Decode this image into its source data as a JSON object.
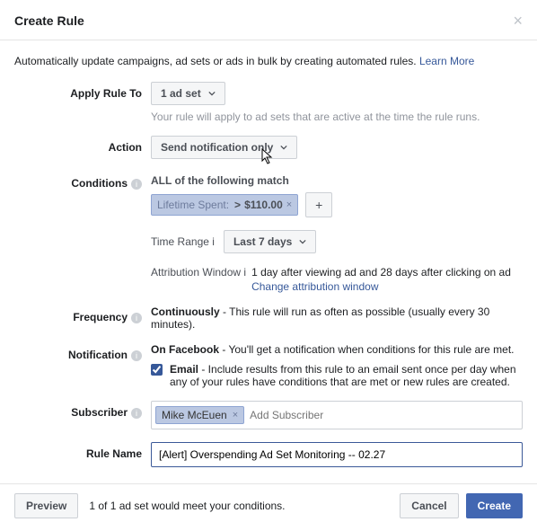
{
  "header": {
    "title": "Create Rule"
  },
  "intro": {
    "text": "Automatically update campaigns, ad sets or ads in bulk by creating automated rules.",
    "learn_more": "Learn More"
  },
  "labels": {
    "apply_rule_to": "Apply Rule To",
    "action": "Action",
    "conditions": "Conditions",
    "frequency": "Frequency",
    "notification": "Notification",
    "subscriber": "Subscriber",
    "rule_name": "Rule Name"
  },
  "apply": {
    "selected": "1 ad set",
    "hint": "Your rule will apply to ad sets that are active at the time the rule runs."
  },
  "action": {
    "selected": "Send notification only"
  },
  "conditions": {
    "match_text": "ALL of the following match",
    "chip": {
      "label": "Lifetime Spent:",
      "op": ">",
      "value": "$110.00"
    },
    "time_range_label": "Time Range",
    "time_range_value": "Last 7 days",
    "attr_label": "Attribution Window",
    "attr_text": "1 day after viewing ad and 28 days after clicking on ad",
    "attr_link": "Change attribution window"
  },
  "frequency": {
    "bold": "Continuously",
    "rest": " - This rule will run as often as possible (usually every 30 minutes)."
  },
  "notification": {
    "fb_bold": "On Facebook",
    "fb_rest": " - You'll get a notification when conditions for this rule are met.",
    "email_bold": "Email",
    "email_rest": " - Include results from this rule to an email sent once per day when any of your rules have conditions that are met or new rules are created."
  },
  "subscriber": {
    "token": "Mike McEuen",
    "placeholder": "Add Subscriber"
  },
  "rule_name": {
    "value": "[Alert] Overspending Ad Set Monitoring -- 02.27"
  },
  "footer": {
    "preview": "Preview",
    "status": "1 of 1 ad set would meet your conditions.",
    "cancel": "Cancel",
    "create": "Create"
  }
}
